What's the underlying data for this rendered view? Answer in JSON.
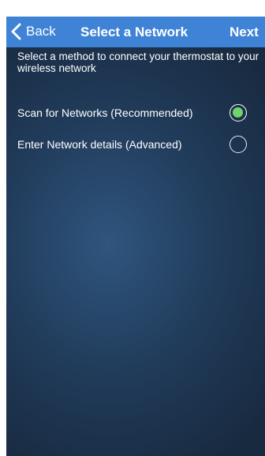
{
  "header": {
    "back_label": "Back",
    "title": "Select a Network",
    "next_label": "Next",
    "background_color": "#3f83d6"
  },
  "main": {
    "instructions": "Select a method to connect your thermostat to your wireless network",
    "options": [
      {
        "label": "Scan for Networks (Recommended)",
        "selected": true
      },
      {
        "label": "Enter Network details (Advanced)",
        "selected": false
      }
    ],
    "selected_color": "#6fd46b"
  }
}
